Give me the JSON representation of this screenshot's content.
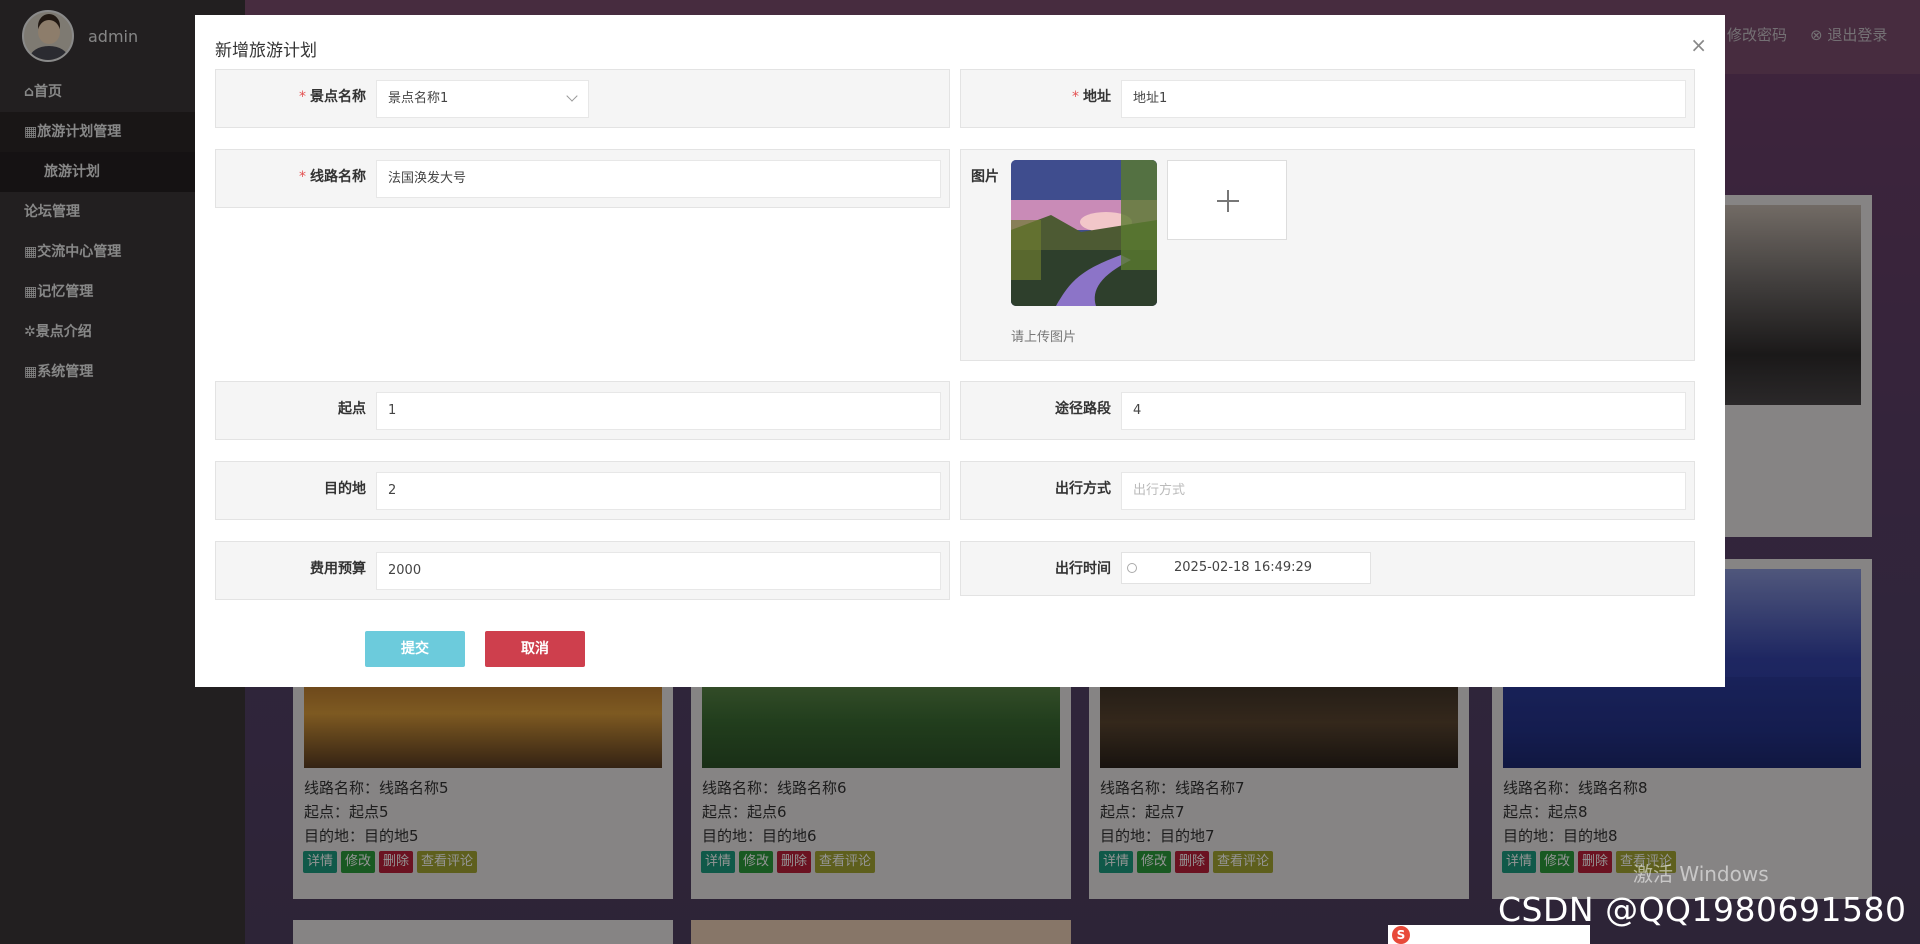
{
  "user": {
    "name": "admin"
  },
  "topbar": {
    "change_password": "修改密码",
    "logout": "退出登录"
  },
  "sidebar": {
    "items": [
      {
        "label": "首页",
        "icon": "home-icon"
      },
      {
        "label": "旅游计划管理",
        "icon": "grid-icon"
      },
      {
        "label": "旅游计划",
        "icon": ""
      },
      {
        "label": "论坛管理",
        "icon": ""
      },
      {
        "label": "交流中心管理",
        "icon": "grid-icon"
      },
      {
        "label": "记忆管理",
        "icon": "grid-icon"
      },
      {
        "label": "景点介绍",
        "icon": "gear-icon"
      },
      {
        "label": "系统管理",
        "icon": "grid-icon"
      }
    ]
  },
  "cards": [
    {
      "route": "线路名称：线路名称5",
      "start": "起点：起点5",
      "dest": "目的地：目的地5"
    },
    {
      "route": "线路名称：线路名称6",
      "start": "起点：起点6",
      "dest": "目的地：目的地6"
    },
    {
      "route": "线路名称：线路名称7",
      "start": "起点：起点7",
      "dest": "目的地：目的地7"
    },
    {
      "route": "线路名称：线路名称8",
      "start": "起点：起点8",
      "dest": "目的地：目的地8"
    }
  ],
  "card_actions": {
    "detail": "详情",
    "edit": "修改",
    "delete": "删除",
    "comments": "查看评论"
  },
  "modal": {
    "title": "新增旅游计划",
    "close": "×",
    "fields": {
      "spot_name": {
        "label": "景点名称",
        "value": "景点名称1"
      },
      "address": {
        "label": "地址",
        "value": "地址1"
      },
      "route_name": {
        "label": "线路名称",
        "value": "法国涣发大号"
      },
      "picture": {
        "label": "图片",
        "hint": "请上传图片"
      },
      "start": {
        "label": "起点",
        "value": "1"
      },
      "waypoints": {
        "label": "途径路段",
        "value": "4"
      },
      "destination": {
        "label": "目的地",
        "value": "2"
      },
      "transport": {
        "label": "出行方式",
        "placeholder": "出行方式"
      },
      "budget": {
        "label": "费用预算",
        "value": "2000"
      },
      "depart_time": {
        "label": "出行时间",
        "value": "2025-02-18 16:49:29"
      }
    },
    "submit": "提交",
    "cancel": "取消"
  },
  "overlays": {
    "windows_activation": "激活 Windows",
    "watermark": "CSDN @QQ1980691580",
    "ime_logo": "S"
  },
  "colors": {
    "sidebar": "#3b3637",
    "submit_button": "#6ccbdc",
    "cancel_button": "#ce3f4d",
    "required_mark": "#e35050"
  }
}
